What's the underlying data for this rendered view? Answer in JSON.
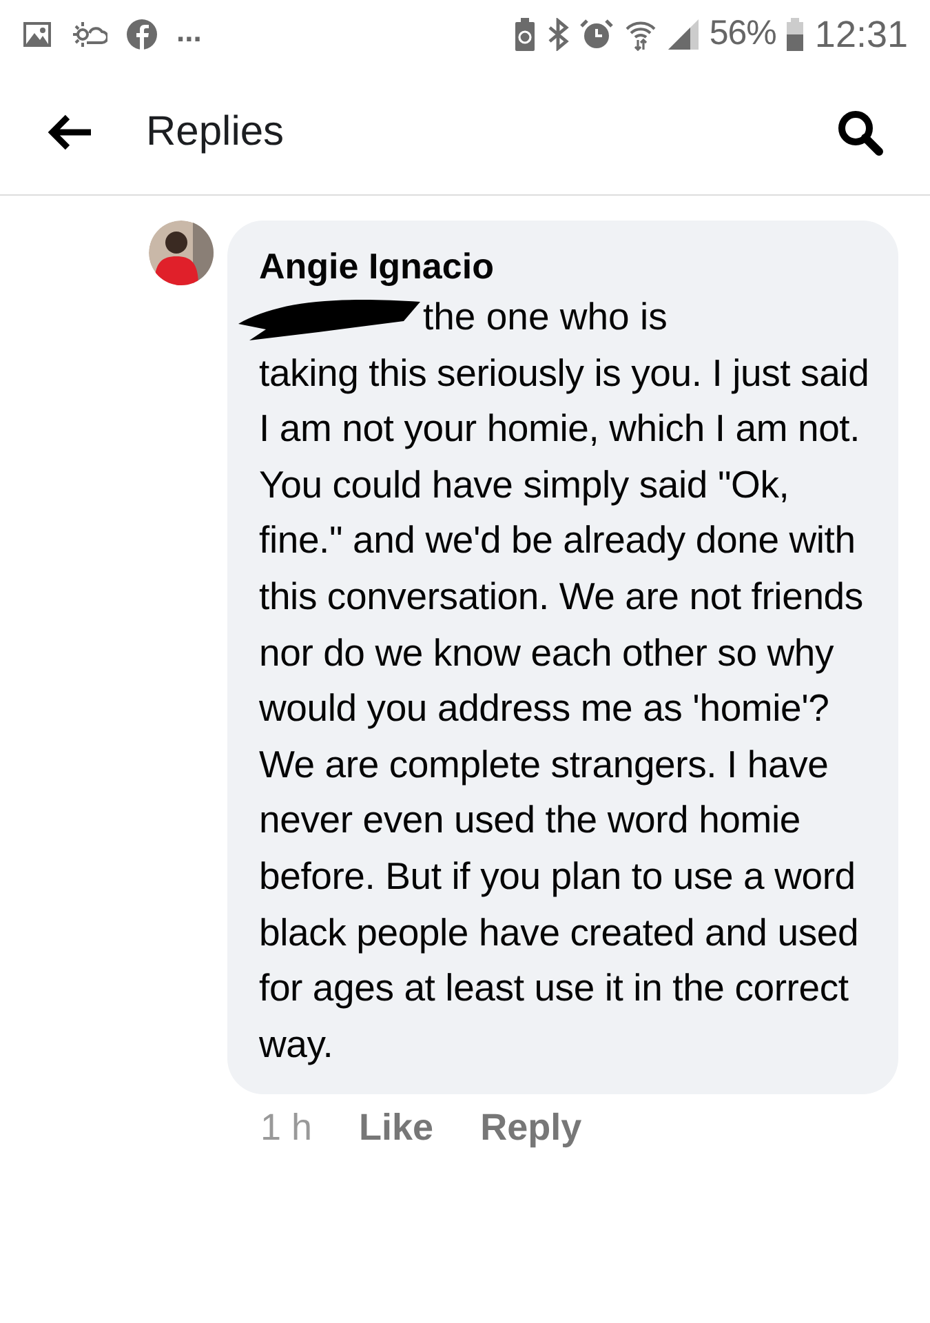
{
  "status_bar": {
    "more": "...",
    "battery_percent": "56%",
    "time": "12:31"
  },
  "header": {
    "title": "Replies"
  },
  "comment": {
    "author": "Angie Ignacio",
    "first_line": "the one who is",
    "text": "taking this seriously is you. I just said I am not your homie, which I am not. You could have simply said \"Ok, fine.\" and we'd be already done with this conversation. We are not friends nor do we know each other so why would you address me as 'homie'? We are complete strangers. I have never even used the word homie before. But if you plan to use a word black people have created and used for ages at least use it in the correct way.",
    "redacted": true,
    "age": "1 h",
    "actions": [
      "Like",
      "Reply"
    ]
  }
}
